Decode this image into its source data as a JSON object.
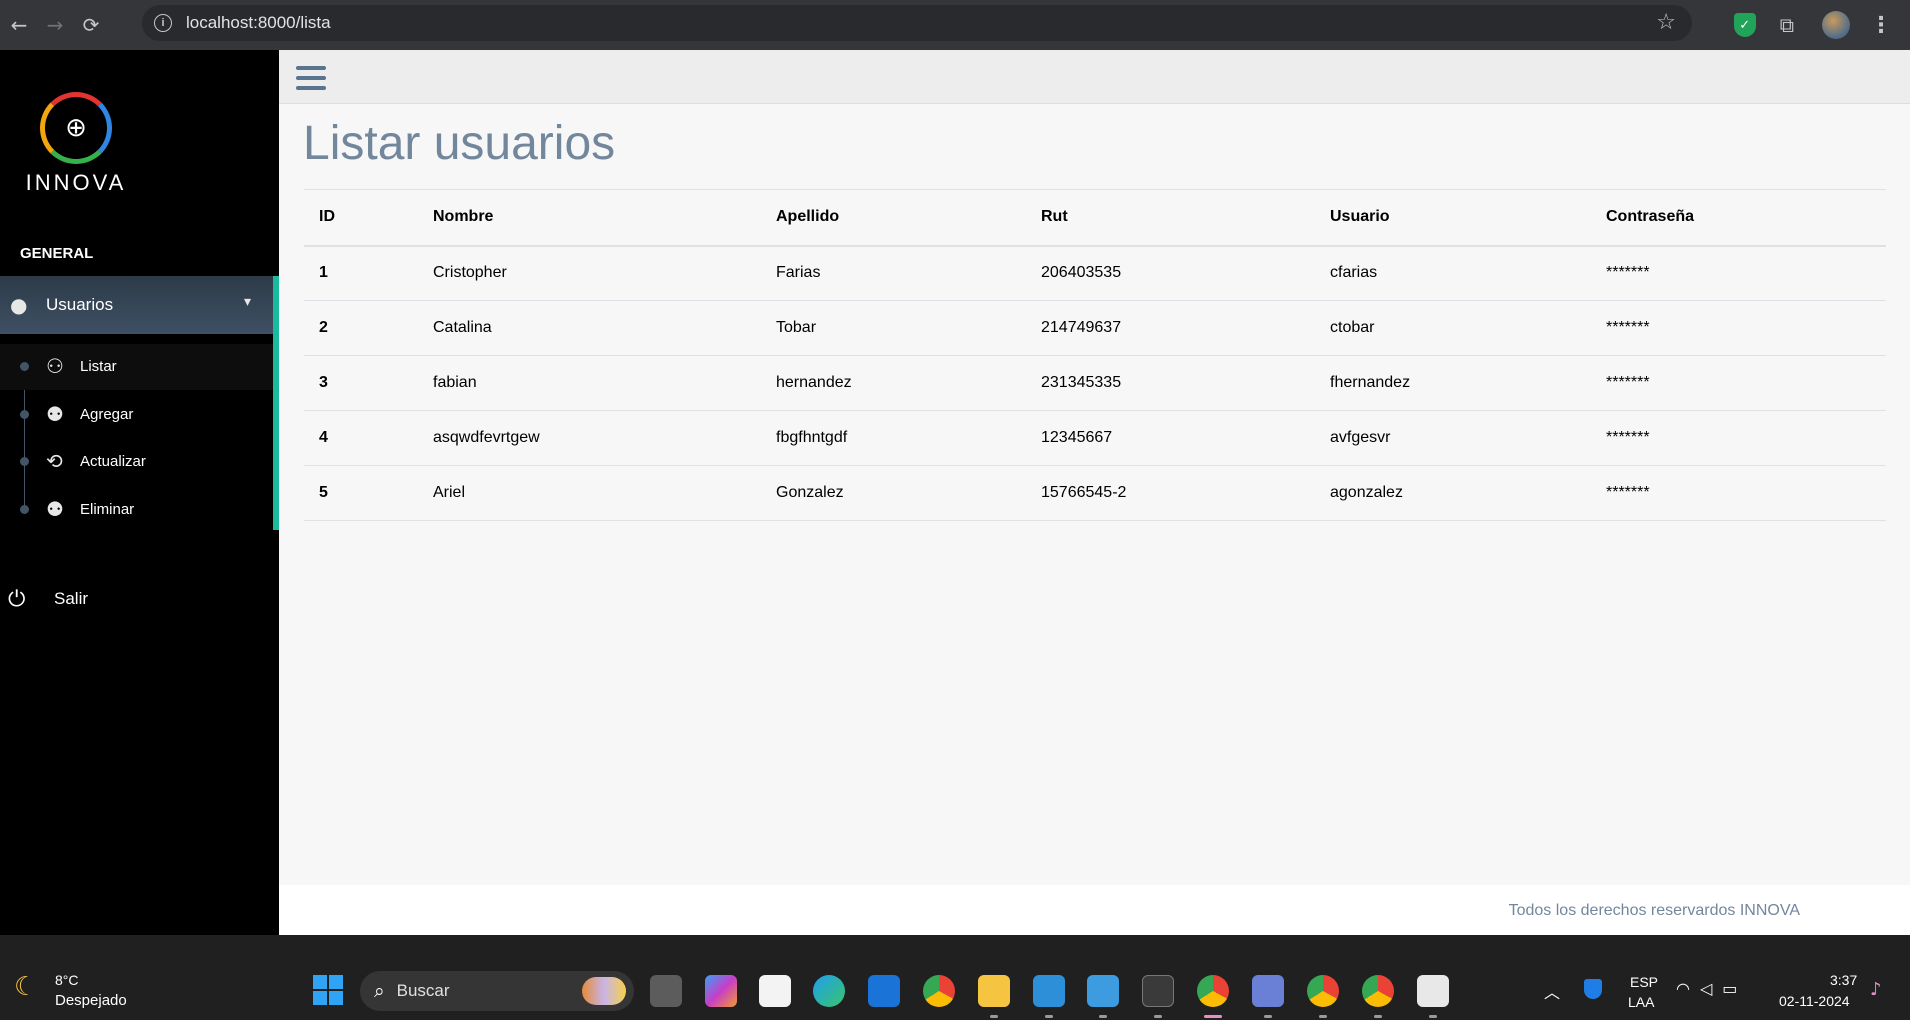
{
  "browser": {
    "url": "localhost:8000/lista",
    "back_icon": "←",
    "forward_icon": "→",
    "reload_icon": "⟳",
    "star_icon": "☆",
    "puzzle_icon": "⧉",
    "kebab_icon": "⋮"
  },
  "sidebar": {
    "logo_text": "INNOVA",
    "section_title": "GENERAL",
    "main_item": {
      "label": "Usuarios",
      "icon": "user-icon"
    },
    "submenu": [
      {
        "label": "Listar",
        "icon": "users-icon",
        "active": true
      },
      {
        "label": "Agregar",
        "icon": "user-plus-icon",
        "active": false
      },
      {
        "label": "Actualizar",
        "icon": "refresh-icon",
        "active": false
      },
      {
        "label": "Eliminar",
        "icon": "user-times-icon",
        "active": false
      }
    ],
    "salir_label": "Salir",
    "accent_color": "#1abb9c"
  },
  "main": {
    "title": "Listar usuarios",
    "table": {
      "headers": [
        "ID",
        "Nombre",
        "Apellido",
        "Rut",
        "Usuario",
        "Contraseña"
      ],
      "rows": [
        [
          "1",
          "Cristopher",
          "Farias",
          "206403535",
          "cfarias",
          "*******"
        ],
        [
          "2",
          "Catalina",
          "Tobar",
          "214749637",
          "ctobar",
          "*******"
        ],
        [
          "3",
          "fabian",
          "hernandez",
          "231345335",
          "fhernandez",
          "*******"
        ],
        [
          "4",
          "asqwdfevrtgew",
          "fbgfhntgdf",
          "12345667",
          "avfgesvr",
          "*******"
        ],
        [
          "5",
          "Ariel",
          "Gonzalez",
          "15766545-2",
          "agonzalez",
          "*******"
        ]
      ]
    }
  },
  "footer": {
    "text": "Todos los derechos reservardos INNOVA"
  },
  "taskbar": {
    "weather_temp": "8°C",
    "weather_desc": "Despejado",
    "search_placeholder": "Buscar",
    "lang_1": "ESP",
    "lang_2": "LAA",
    "time": "3:37",
    "date": "02-11-2024"
  }
}
